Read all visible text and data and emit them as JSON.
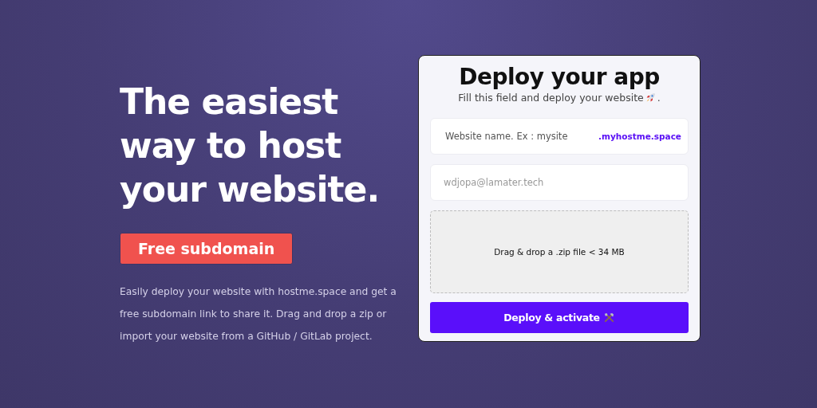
{
  "hero": {
    "headline_lines": [
      "The easiest",
      "way to host",
      "your website."
    ],
    "cta": "Free subdomain",
    "description": "Easily deploy your website with hostme.space and get a free subdomain link to share it. Drag and drop a zip or import your website from a GitHub / GitLab project."
  },
  "form": {
    "title": "Deploy your app",
    "subtitle": "Fill this field and deploy your website",
    "subtitle_end": ".",
    "site_field": {
      "placeholder": "Website name. Ex : mysite",
      "suffix": ".myhostme.space"
    },
    "email_field": {
      "placeholder": "wdjopa@lamater.tech"
    },
    "dropzone": "Drag & drop a .zip file < 34 MB",
    "submit": "Deploy & activate"
  }
}
